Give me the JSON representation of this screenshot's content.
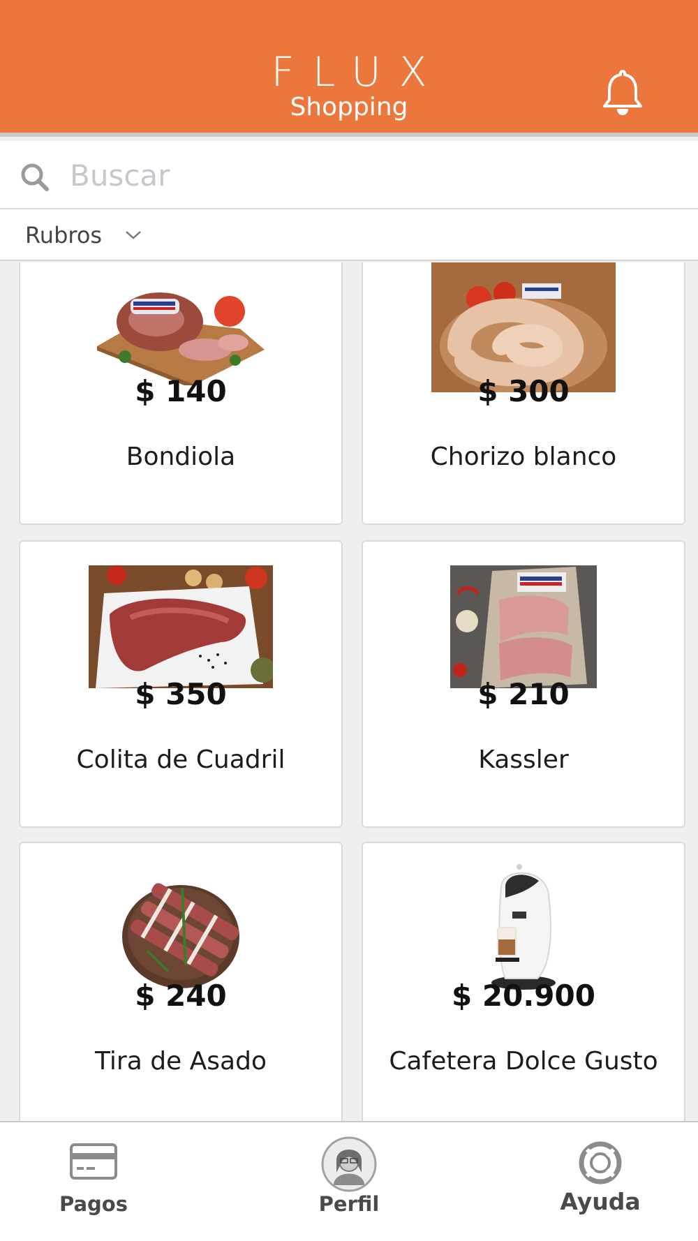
{
  "header": {
    "brand_top": "FLUX",
    "brand_bottom": "Shopping",
    "color": "#ec773d",
    "icons": {
      "notifications": "bell-icon"
    }
  },
  "search": {
    "placeholder": "Buscar",
    "icon": "search-icon"
  },
  "filter": {
    "label": "Rubros",
    "icon": "chevron-down-icon"
  },
  "products": [
    {
      "price": "$ 140",
      "name": "Bondiola",
      "image": "pork-neck-photo"
    },
    {
      "price": "$ 300",
      "name": "Chorizo blanco",
      "image": "sausage-photo"
    },
    {
      "price": "$ 350",
      "name": "Colita de Cuadril",
      "image": "beef-cut-photo"
    },
    {
      "price": "$ 210",
      "name": "Kassler",
      "image": "kassler-photo"
    },
    {
      "price": "$ 240",
      "name": "Tira de Asado",
      "image": "short-ribs-photo"
    },
    {
      "price": "$ 20.900",
      "name": "Cafetera Dolce Gusto",
      "image": "coffee-machine-photo"
    }
  ],
  "bottom_nav": {
    "items": [
      {
        "label": "Pagos",
        "icon": "credit-card-icon"
      },
      {
        "label": "Perfil",
        "icon": "avatar"
      },
      {
        "label": "Ayuda",
        "icon": "lifebuoy-icon"
      }
    ]
  }
}
